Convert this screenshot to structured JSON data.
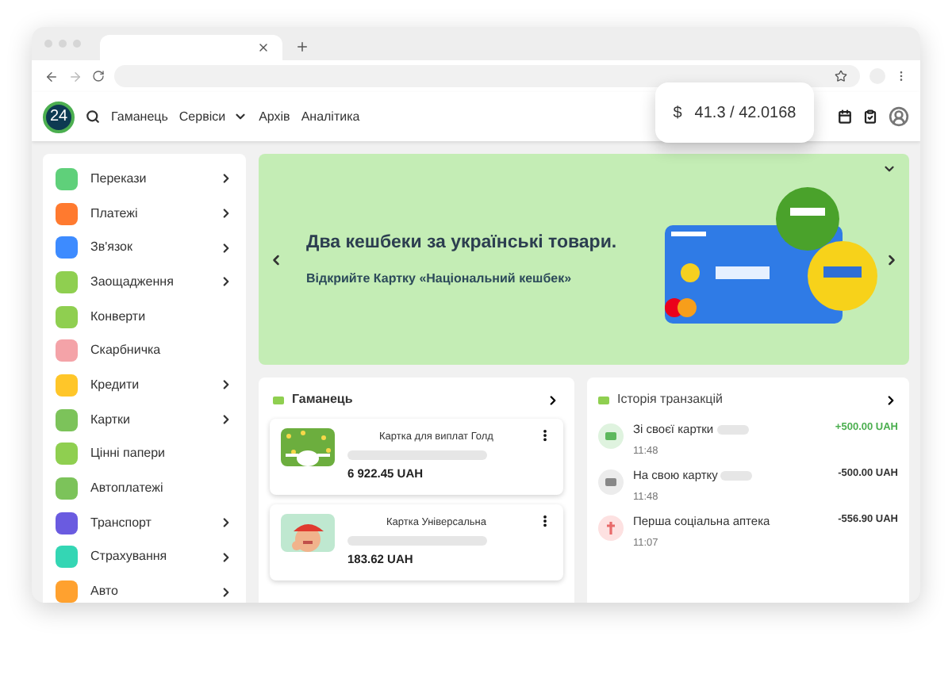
{
  "header": {
    "logo": "24",
    "nav": [
      {
        "label": "Гаманець",
        "dropdown": false
      },
      {
        "label": "Сервіси",
        "dropdown": true
      },
      {
        "label": "Архів",
        "dropdown": false
      },
      {
        "label": "Аналітика",
        "dropdown": false
      }
    ],
    "rate": {
      "symbol": "$",
      "value": "41.3 / 42.0168"
    }
  },
  "sidebar": {
    "items": [
      {
        "label": "Перекази",
        "color": "#5fd07a",
        "expandable": true
      },
      {
        "label": "Платежі",
        "color": "#ff7a2f",
        "expandable": true
      },
      {
        "label": "Зв'язок",
        "color": "#3d8bff",
        "expandable": true
      },
      {
        "label": "Заощадження",
        "color": "#8fcf50",
        "expandable": true
      },
      {
        "label": "Конверти",
        "color": "#8fcf50",
        "expandable": false
      },
      {
        "label": "Скарбничка",
        "color": "#f4a3a8",
        "expandable": false
      },
      {
        "label": "Кредити",
        "color": "#ffc629",
        "expandable": true
      },
      {
        "label": "Картки",
        "color": "#7cc35a",
        "expandable": true
      },
      {
        "label": "Цінні папери",
        "color": "#8fcf50",
        "expandable": false
      },
      {
        "label": "Автоплатежі",
        "color": "#7cc35a",
        "expandable": false
      },
      {
        "label": "Транспорт",
        "color": "#6a5be0",
        "expandable": true
      },
      {
        "label": "Страхування",
        "color": "#34d6b4",
        "expandable": true
      },
      {
        "label": "Авто",
        "color": "#ffa12f",
        "expandable": true
      }
    ]
  },
  "banner": {
    "title": "Два кешбеки за українські товари.",
    "subtitle": "Відкрийте Картку «Національний кешбек»"
  },
  "wallet": {
    "title": "Гаманець",
    "cards": [
      {
        "name": "Картка для виплат Голд",
        "balance": "6 922.45 UAH",
        "kind": "confetti"
      },
      {
        "name": "Картка Універсальна",
        "balance": "183.62 UAH",
        "kind": "character"
      }
    ]
  },
  "history": {
    "title": "Історія транзакцій",
    "items": [
      {
        "title": "Зі своєї картки",
        "time": "11:48",
        "amount": "+500.00 UAH",
        "kind": "income"
      },
      {
        "title": "На свою картку",
        "time": "11:48",
        "amount": "-500.00 UAH",
        "kind": "transfer"
      },
      {
        "title": "Перша соціальна аптека",
        "time": "11:07",
        "amount": "-556.90 UAH",
        "kind": "pharmacy"
      }
    ]
  }
}
